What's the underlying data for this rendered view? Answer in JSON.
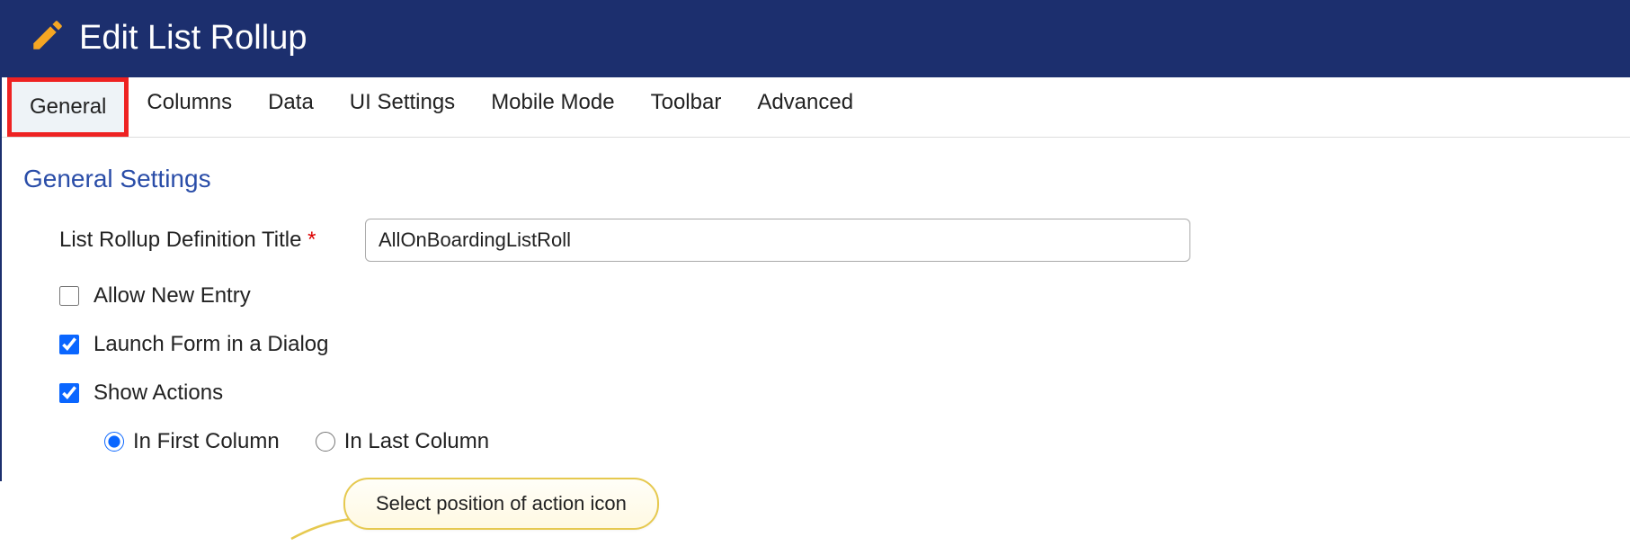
{
  "header": {
    "title": "Edit List Rollup"
  },
  "tabs": [
    {
      "label": "General",
      "active": true
    },
    {
      "label": "Columns",
      "active": false
    },
    {
      "label": "Data",
      "active": false
    },
    {
      "label": "UI Settings",
      "active": false
    },
    {
      "label": "Mobile Mode",
      "active": false
    },
    {
      "label": "Toolbar",
      "active": false
    },
    {
      "label": "Advanced",
      "active": false
    }
  ],
  "section": {
    "title": "General Settings",
    "titleField": {
      "label": "List Rollup Definition Title",
      "required": "*",
      "value": "AllOnBoardingListRoll"
    },
    "allowNew": {
      "label": "Allow New Entry",
      "checked": false
    },
    "launchDialog": {
      "label": "Launch Form in a Dialog",
      "checked": true
    },
    "showActions": {
      "label": "Show Actions",
      "checked": true
    },
    "position": {
      "first": {
        "label": "In First Column",
        "checked": true
      },
      "last": {
        "label": "In Last Column",
        "checked": false
      }
    }
  },
  "callout": {
    "text": "Select position of action icon"
  }
}
